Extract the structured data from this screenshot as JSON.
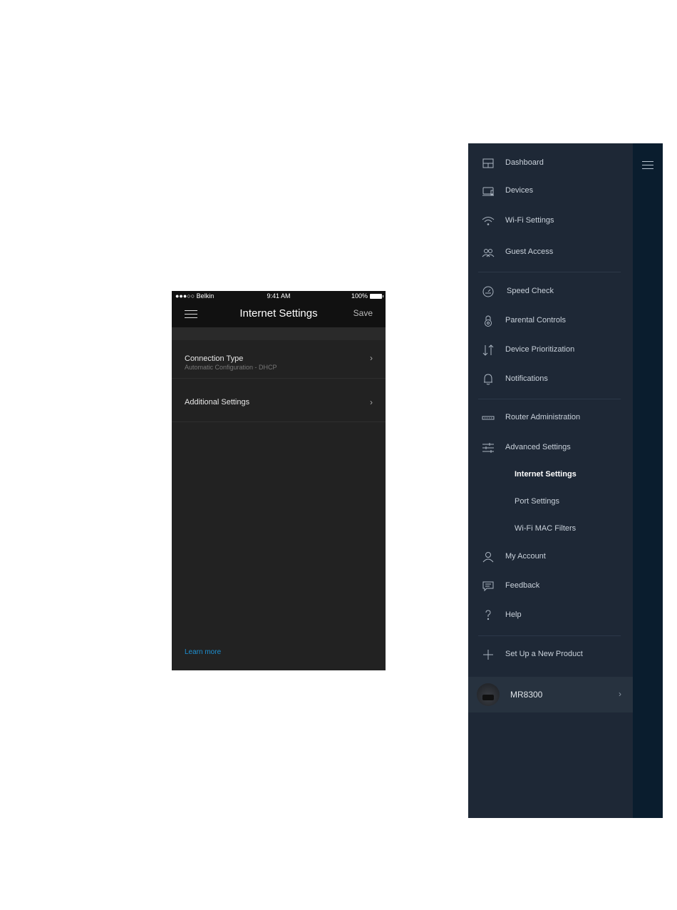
{
  "phone": {
    "status": {
      "carrier": "●●●○○ Belkin",
      "time": "9:41 AM",
      "battery": "100%"
    },
    "title": "Internet Settings",
    "save_label": "Save",
    "rows": [
      {
        "label": "Connection Type",
        "sub": "Automatic Configuration - DHCP",
        "chevron": "›"
      },
      {
        "label": "Additional Settings",
        "chevron": "›"
      }
    ],
    "learn_more": "Learn more"
  },
  "menu": {
    "items": [
      {
        "label": "Dashboard",
        "icon": "dashboard-icon"
      },
      {
        "label": "Devices",
        "icon": "devices-icon"
      },
      {
        "label": "Wi-Fi Settings",
        "icon": "wifi-icon"
      },
      {
        "label": "Guest Access",
        "icon": "guest-icon"
      },
      {
        "label": "Speed Check",
        "icon": "speedometer-icon"
      },
      {
        "label": "Parental Controls",
        "icon": "lock-icon"
      },
      {
        "label": "Device Prioritization",
        "icon": "priority-arrows-icon"
      },
      {
        "label": "Notifications",
        "icon": "bell-icon"
      },
      {
        "label": "Router Administration",
        "icon": "router-icon"
      },
      {
        "label": "Advanced Settings",
        "icon": "sliders-icon"
      },
      {
        "label": "My Account",
        "icon": "user-icon"
      },
      {
        "label": "Feedback",
        "icon": "chat-icon"
      },
      {
        "label": "Help",
        "icon": "question-icon"
      },
      {
        "label": "Set Up a New Product",
        "icon": "plus-icon"
      }
    ],
    "advanced_sub": [
      {
        "label": "Internet Settings",
        "active": true
      },
      {
        "label": "Port Settings"
      },
      {
        "label": "Wi-Fi MAC Filters"
      }
    ],
    "device": {
      "name": "MR8300",
      "chevron": "›"
    }
  },
  "colors": {
    "phone_bg": "#222222",
    "menu_bg": "#1e2836",
    "menu_strip": "#0a1d2e",
    "link": "#1e8fd0"
  }
}
